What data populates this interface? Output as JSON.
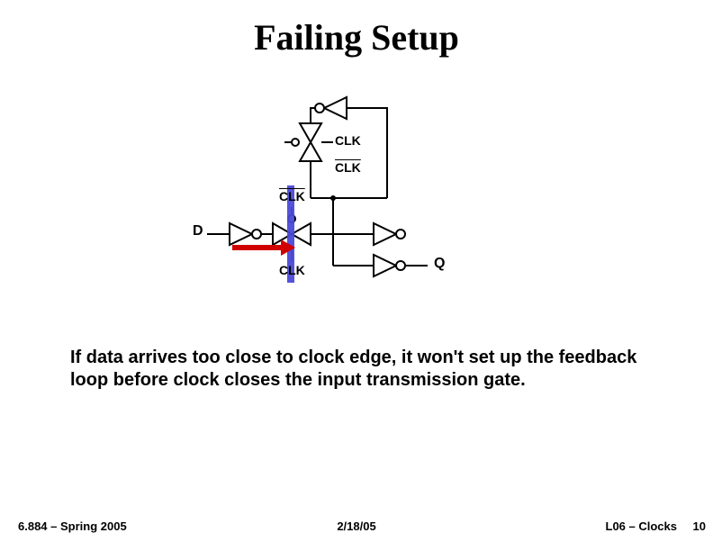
{
  "title": "Failing Setup",
  "labels": {
    "D": "D",
    "Q": "Q",
    "clk_top1": "CLK",
    "clk_top2": "CLK",
    "clk_left_top": "CLK",
    "clk_left_bot": "CLK"
  },
  "paragraph": "If data arrives too close to clock edge, it won't set up the feedback loop before clock closes the input transmission gate.",
  "footer": {
    "left": "6.884 – Spring 2005",
    "mid": "2/18/05",
    "right": "L06 – Clocks",
    "page": "10"
  }
}
